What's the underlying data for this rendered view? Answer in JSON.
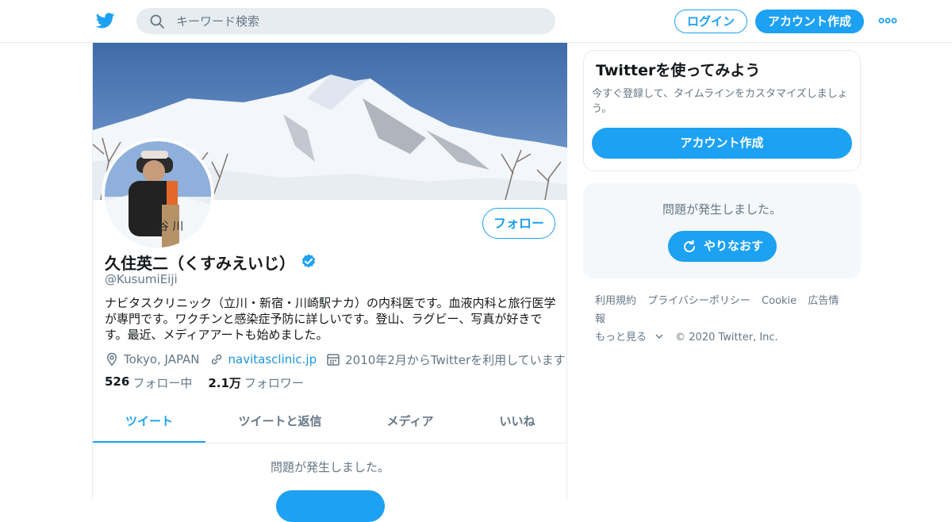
{
  "header": {
    "search_placeholder": "キーワード検索",
    "login_label": "ログイン",
    "signup_label": "アカウント作成"
  },
  "profile": {
    "name": "久住英二（くすみえいじ）",
    "handle": "@KusumiEiji",
    "bio": "ナビタスクリニック（立川・新宿・川崎駅ナカ）の内科医です。血液内科と旅行医学が専門です。ワクチンと感染症予防に詳しいです。登山、ラグビー、写真が好きです。最近、メディアアートも始めました。",
    "location": "Tokyo, JAPAN",
    "website": "navitasclinic.jp",
    "joined": "2010年2月からTwitterを利用しています",
    "following_count": "526",
    "following_label": "フォロー中",
    "followers_count": "2.1万",
    "followers_label": "フォロワー",
    "follow_button": "フォロー",
    "avatar_sign": "谷 川"
  },
  "tabs": [
    {
      "label": "ツイート",
      "active": true
    },
    {
      "label": "ツイートと返信",
      "active": false
    },
    {
      "label": "メディア",
      "active": false
    },
    {
      "label": "いいね",
      "active": false
    }
  ],
  "timeline": {
    "error_text": "問題が発生しました。"
  },
  "sidebar": {
    "signup_card": {
      "title": "Twitterを使ってみよう",
      "description": "今すぐ登録して、タイムラインをカスタマイズしましょう。",
      "button": "アカウント作成"
    },
    "error_card": {
      "text": "問題が発生しました。",
      "retry": "やりなおす"
    },
    "footer": {
      "links": [
        "利用規約",
        "プライバシーポリシー",
        "Cookie",
        "広告情報"
      ],
      "more": "もっと見る",
      "copyright": "© 2020 Twitter, Inc."
    }
  },
  "colors": {
    "accent": "#1da1f2",
    "secondary_text": "#657786",
    "border": "#e6ecf0"
  }
}
